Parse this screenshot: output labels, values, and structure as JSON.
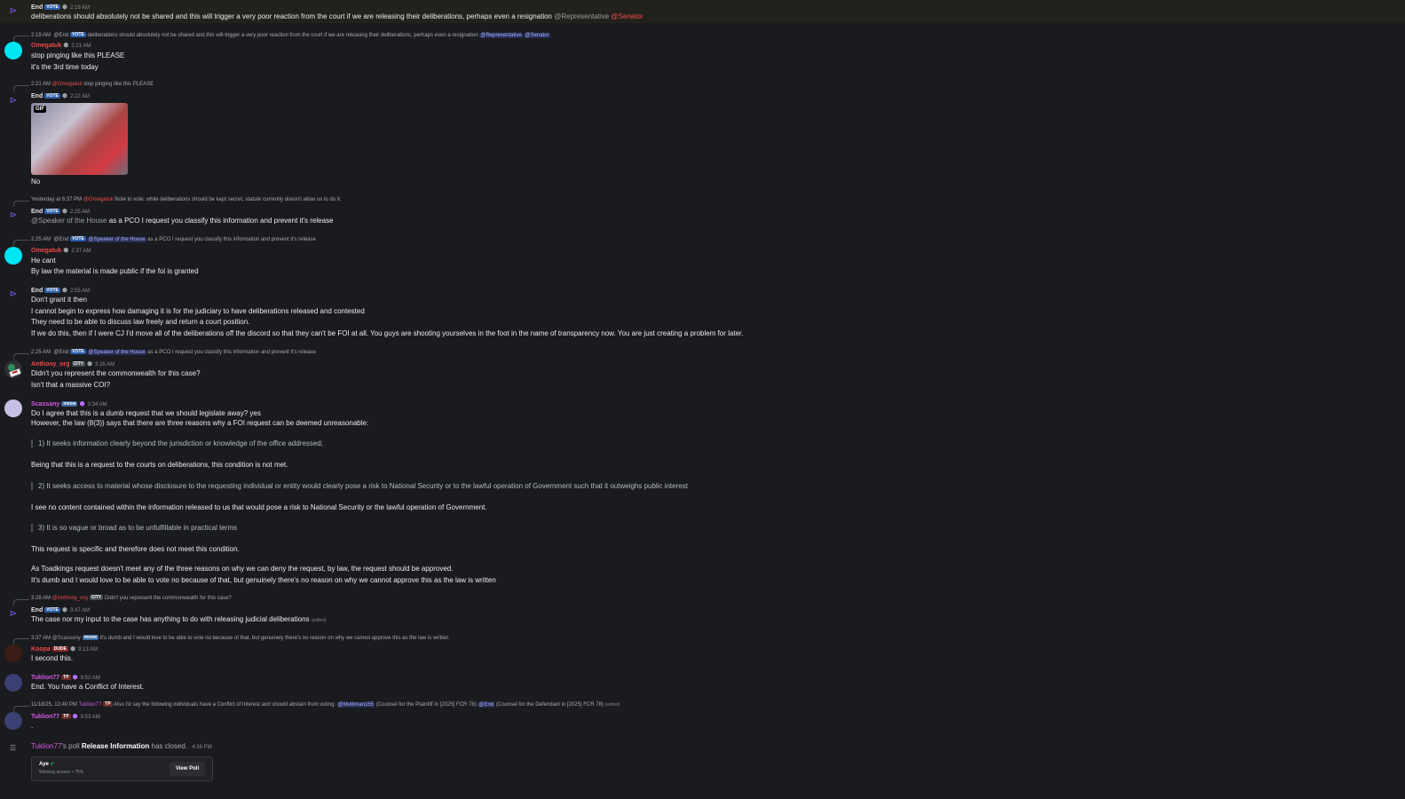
{
  "m1": {
    "name": "End",
    "badge": "VOTE",
    "time": "2:19 AM",
    "text": "deliberations should absolutely not be shared and this will trigger a very poor reaction from the court if we are releasing their deliberations, perhaps even a resignation",
    "mention_rep": "@Representative",
    "mention_sen": "@Senator"
  },
  "m2": {
    "reply_time": "2:19 AM",
    "reply_name": "@End",
    "reply_badge": "VOTE",
    "reply_text": "deliberations should absolutely not be shared and this will trigger a very poor reaction from the court if we are releasing their deliberations, perhaps even a resignation",
    "reply_rep": "@Representative",
    "reply_sen": "@Senator",
    "name": "Omegatuk",
    "time": "2:21 AM",
    "line1": "stop pinging like this PLEASE",
    "line2": "it's the 3rd time today"
  },
  "m3": {
    "reply_time": "2:21 AM",
    "reply_name": "@Omegatuk",
    "reply_text": "stop pinging like this PLEASE",
    "name": "End",
    "badge": "VOTE",
    "time": "2:22 AM",
    "gif": "GIF",
    "text": "No"
  },
  "m4": {
    "reply_time": "Yesterday at 6:37 PM",
    "reply_name": "@Omegatuk",
    "reply_text": "Note to vote: while deliberations should be kept secret, statute currently doesn't allow us to do it.",
    "name": "End",
    "badge": "VOTE",
    "time": "2:25 AM",
    "mention": "@Speaker of the House",
    "text": "as a PCO I request you classify this information and prevent it's release"
  },
  "m5": {
    "reply_time": "2:25 AM",
    "reply_name": "@End",
    "reply_badge": "VOTE",
    "reply_mention": "@Speaker of the House",
    "reply_text": "as a PCO I request you classify this information and prevent it's release",
    "name": "Omegatuk",
    "time": "2:37 AM",
    "line1": "He cant",
    "line2": "By law the material is made public if the foi is granted"
  },
  "m6": {
    "name": "End",
    "badge": "VOTE",
    "time": "2:55 AM",
    "line1": "Don't grant it then",
    "line2": "I cannot begin to express how damaging it is for the judiciary to have deliberations released and contested",
    "line3": "They need to be able to discuss law freely and return a court position.",
    "line4": "If we do this, then if I were CJ I'd move all of the deliberations off the discord so that they can't be FOI at all. You guys are shooting yourselves in the foot in the name of transparency now. You are just creating a problem for later."
  },
  "m7": {
    "reply_time": "2:25 AM",
    "reply_name": "@End",
    "reply_badge": "VOTE",
    "reply_mention": "@Speaker of the House",
    "reply_text": "as a PCO I request you classify this information and prevent it's release",
    "name": "Anthony_org",
    "badge": "CITY",
    "time": "3:28 AM",
    "line1": "Didn't you represent the commonwealth for this case?",
    "line2": "Isn't that a massive COI?"
  },
  "m8": {
    "name": "Scassany",
    "badge": "meow",
    "time": "3:34 AM",
    "line1": "Do I agree that this is a dumb request that we should legislate away? yes",
    "line2": "However, the law (8(3)) says that there are three reasons why a FOI request can be deemed unreasonable:",
    "q1": "1) It seeks information clearly beyond the jurisdiction or knowledge of the office addressed;",
    "b1": "Being that this is a request to the courts on deliberations, this condition is not met.",
    "q2": "2) It seeks access to material whose disclosure to the requesting individual or entity would clearly pose a risk to National Security or to the lawful operation of Government such that it outweighs public interest",
    "b2": "I see no content contained within the information released to us that would pose a risk to National Security or the lawful operation of Government.",
    "q3": "3)  It is so vague or broad as to be unfulfillable in practical terms",
    "b3": "This request is specific and therefore does not meet this condition.",
    "line3": "As Toadkings request doesn't meet any of the three reasons on why we can deny the request, by law, the request should be approved.",
    "line4": "It's dumb and I would love to be able to vote no because of that, but genuinely there's no reason on why we cannot approve this as the law is written"
  },
  "m9": {
    "reply_time": "3:28 AM",
    "reply_name": "@Anthony_org",
    "reply_badge": "CITY",
    "reply_text": "Didn't you represent the commonwealth for this case?",
    "name": "End",
    "badge": "VOTE",
    "time": "3:47 AM",
    "text": "The case nor my input to the case has anything to do with releasing judicial deliberations",
    "edited": "(edited)"
  },
  "m10": {
    "reply_time": "3:37 AM",
    "reply_name": "@Scassany",
    "reply_badge": "meow",
    "reply_text": "It's dumb and I would love to be able to vote no because of that, but genuinely there's no reason on why we cannot approve this as the law is written",
    "name": "Koopa",
    "badge": "DUDE",
    "time": "9:13 AM",
    "text": "I second this."
  },
  "m11": {
    "name": "Tuklion77",
    "badge": "TP",
    "time": "9:52 AM",
    "text": "End. You have a Conflict of Interest."
  },
  "m12": {
    "reply_time": "11/18/25, 12:40 PM",
    "reply_name": "Tuklion77",
    "reply_badge": "TP",
    "reply_text": "Also I'd say the following individuals have a Conflict of Interest and should abstain from voting:",
    "reply_m1": "@Multiman155",
    "reply_t1": "(Counsel for the Plaintiff in [2025] FCR 78)",
    "reply_m2": "@End",
    "reply_t2": "(Counsel for the Defendant in [2025] FCR 78)",
    "reply_edited": "(edited)",
    "name": "Tuklion77",
    "badge": "TP",
    "time": "9:53 AM",
    "text": "."
  },
  "poll": {
    "owner": "Tuklion77",
    "mid": "'s poll",
    "title": "Release Information",
    "status": "has closed.",
    "time": "4:36 PM",
    "answer": "Aye",
    "answer_sub": "Winning answer • 75%",
    "button": "View Poll"
  }
}
